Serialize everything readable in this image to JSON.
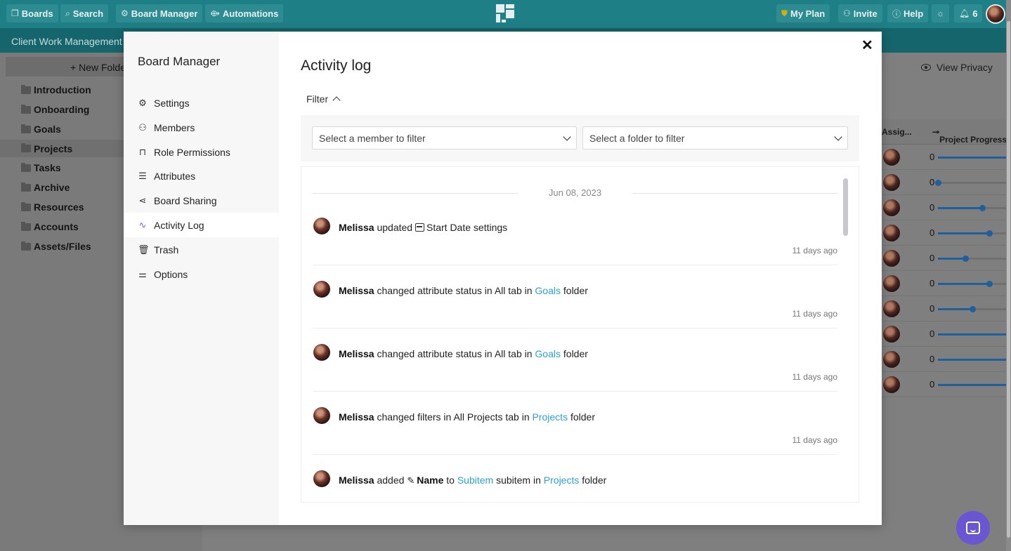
{
  "topbar": {
    "boards": "Boards",
    "search": "Search",
    "board_manager": "Board Manager",
    "automations": "Automations",
    "my_plan": "My Plan",
    "invite": "Invite",
    "help": "Help",
    "notifications": "6",
    "colors": {
      "bar": "#1f7f86",
      "accent_purple": "#7d5ad8",
      "link": "#2aa2d6"
    }
  },
  "subbar": {
    "title": "Client Work Management"
  },
  "sidebar": {
    "new_folder": "+ New Folder",
    "folders": [
      "Introduction",
      "Onboarding",
      "Goals",
      "Projects",
      "Tasks",
      "Archive",
      "Resources",
      "Accounts",
      "Assets/Files"
    ],
    "selected": "Projects"
  },
  "main": {
    "view_privacy": "View Privacy",
    "columns": [
      "Assig...",
      "Project Progress"
    ],
    "rows": [
      {
        "value": "0",
        "progress": 1.0
      },
      {
        "value": "0",
        "progress": 0.0
      },
      {
        "value": "0",
        "progress": 0.65
      },
      {
        "value": "0",
        "progress": 0.75
      },
      {
        "value": "0",
        "progress": 0.4
      },
      {
        "value": "0",
        "progress": 0.75
      },
      {
        "value": "0",
        "progress": 0.5
      },
      {
        "value": "0",
        "progress": 1.0
      },
      {
        "value": "0",
        "progress": 1.0
      },
      {
        "value": "0",
        "progress": 1.0
      }
    ]
  },
  "modal": {
    "side_title": "Board Manager",
    "nav": [
      {
        "label": "Settings",
        "icon": "gear-icon"
      },
      {
        "label": "Members",
        "icon": "person-icon"
      },
      {
        "label": "Role Permissions",
        "icon": "lock-icon"
      },
      {
        "label": "Attributes",
        "icon": "list-icon"
      },
      {
        "label": "Board Sharing",
        "icon": "share-icon"
      },
      {
        "label": "Activity Log",
        "icon": "activity-icon"
      },
      {
        "label": "Trash",
        "icon": "trash-icon"
      },
      {
        "label": "Options",
        "icon": "sliders-icon"
      }
    ],
    "active_nav": "Activity Log",
    "title": "Activity log",
    "filter_label": "Filter",
    "member_filter_placeholder": "Select a member to filter",
    "folder_filter_placeholder": "Select a folder to filter",
    "date_label": "Jun 08, 2023",
    "entries": [
      {
        "user": "Melissa",
        "time": "11 days ago"
      },
      {
        "user": "Melissa",
        "time": "11 days ago"
      },
      {
        "user": "Melissa",
        "time": "11 days ago"
      },
      {
        "user": "Melissa",
        "time": "11 days ago"
      },
      {
        "user": "Melissa",
        "time": ""
      }
    ],
    "e1": {
      "action": "updated",
      "target": "Start Date settings"
    },
    "e2": {
      "text1": "changed attribute status in All tab in",
      "link": "Goals",
      "text2": "folder"
    },
    "e3": {
      "text1": "changed attribute status in All tab in",
      "link": "Goals",
      "text2": "folder"
    },
    "e4": {
      "text1": "changed filters in All Projects tab in",
      "link": "Projects",
      "text2": "folder"
    },
    "e5": {
      "action": "added",
      "field": "Name",
      "to": "to",
      "subitem_link": "Subitem",
      "mid": "subitem in",
      "folder_link": "Projects",
      "end": "folder"
    }
  }
}
